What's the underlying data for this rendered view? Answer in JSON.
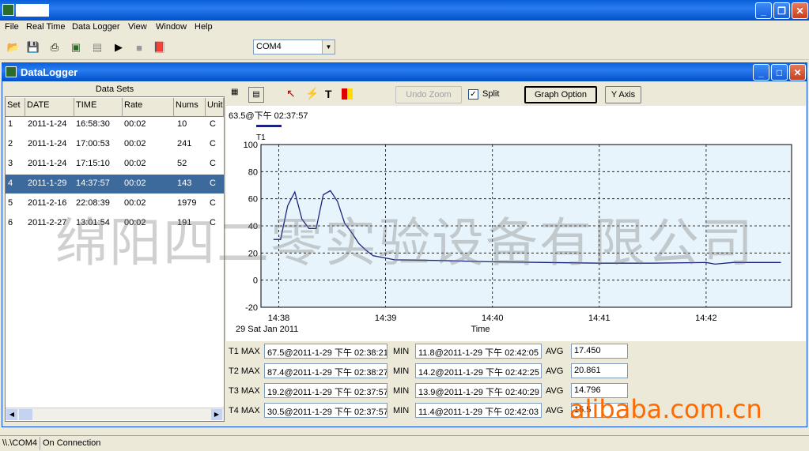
{
  "app": {
    "title": ""
  },
  "menu": [
    "File",
    "Real Time",
    "Data Logger",
    "View",
    "Window",
    "Help"
  ],
  "toolbar": {
    "port": "COM4"
  },
  "child": {
    "title": "DataLogger"
  },
  "datasets": {
    "header": "Data Sets",
    "columns": [
      "Set",
      "DATE",
      "TIME",
      "Rate",
      "Nums",
      "Unit"
    ],
    "rows": [
      {
        "set": "1",
        "date": "2011-1-24",
        "time": "16:58:30",
        "rate": "00:02",
        "nums": "10",
        "unit": "C"
      },
      {
        "set": "2",
        "date": "2011-1-24",
        "time": "17:00:53",
        "rate": "00:02",
        "nums": "241",
        "unit": "C"
      },
      {
        "set": "3",
        "date": "2011-1-24",
        "time": "17:15:10",
        "rate": "00:02",
        "nums": "52",
        "unit": "C"
      },
      {
        "set": "4",
        "date": "2011-1-29",
        "time": "14:37:57",
        "rate": "00:02",
        "nums": "143",
        "unit": "C"
      },
      {
        "set": "5",
        "date": "2011-2-16",
        "time": "22:08:39",
        "rate": "00:02",
        "nums": "1979",
        "unit": "C"
      },
      {
        "set": "6",
        "date": "2011-2-27",
        "time": "13:01:54",
        "rate": "00:02",
        "nums": "191",
        "unit": "C"
      }
    ],
    "selected": 3
  },
  "graph_toolbar": {
    "undo_zoom": "Undo Zoom",
    "split": "Split",
    "graph_option": "Graph Option",
    "y_axis": "Y Axis"
  },
  "cursor_readout": "63.5@下午 02:37:57",
  "chart_data": {
    "type": "line",
    "series": [
      {
        "name": "T1",
        "color": "#1a237e",
        "x": [
          "14:37:57",
          "14:38:01",
          "14:38:05",
          "14:38:09",
          "14:38:13",
          "14:38:17",
          "14:38:21",
          "14:38:25",
          "14:38:29",
          "14:38:33",
          "14:38:37",
          "14:38:41",
          "14:38:45",
          "14:38:49",
          "14:38:53",
          "14:39:05",
          "14:39:30",
          "14:40:00",
          "14:40:30",
          "14:41:00",
          "14:41:30",
          "14:42:00",
          "14:42:05",
          "14:42:15",
          "14:42:29",
          "14:42:42"
        ],
        "y": [
          30,
          30,
          55,
          65,
          45,
          38,
          38,
          63,
          66,
          58,
          42,
          35,
          27,
          22,
          18,
          15,
          14.5,
          13.5,
          13,
          12.5,
          12.5,
          13,
          11.8,
          13,
          13,
          13
        ]
      }
    ],
    "xlabel": "Time",
    "x_ticks": [
      "14:38",
      "14:39",
      "14:40",
      "14:41",
      "14:42"
    ],
    "date_label": "29 Sat Jan 2011",
    "ylim": [
      -20,
      100
    ],
    "y_ticks": [
      100,
      80,
      60,
      40,
      20,
      0,
      -20
    ],
    "grid": true
  },
  "stats": [
    {
      "label": "T1 MAX",
      "max": "67.5@2011-1-29 下午 02:38:21",
      "min": "11.8@2011-1-29 下午 02:42:05",
      "avg": "17.450"
    },
    {
      "label": "T2 MAX",
      "max": "87.4@2011-1-29 下午 02:38:27",
      "min": "14.2@2011-1-29 下午 02:42:25",
      "avg": "20.861"
    },
    {
      "label": "T3 MAX",
      "max": "19.2@2011-1-29 下午 02:37:57",
      "min": "13.9@2011-1-29 下午 02:40:29",
      "avg": "14.796"
    },
    {
      "label": "T4 MAX",
      "max": "30.5@2011-1-29 下午 02:37:57",
      "min": "11.4@2011-1-29 下午 02:42:03",
      "avg": "15.5"
    }
  ],
  "stats_labels": {
    "min": "MIN",
    "avg": "AVG"
  },
  "status": {
    "path": "\\\\.\\COM4",
    "connection": "On Connection"
  },
  "watermark": "绵阳四二零实验设备有限公司",
  "ali_watermark": "alibaba.com.cn"
}
